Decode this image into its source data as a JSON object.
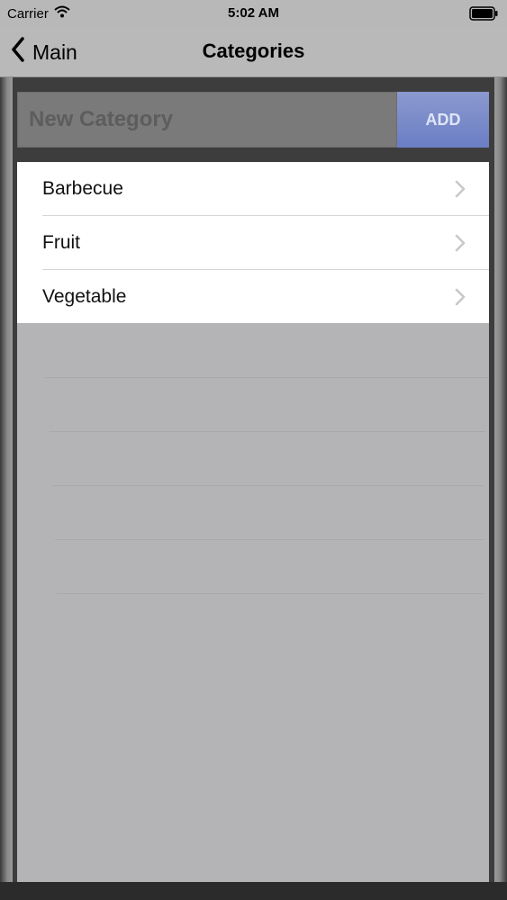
{
  "status_bar": {
    "carrier": "Carrier",
    "time": "5:02 AM"
  },
  "nav": {
    "back_label": "Main",
    "title": "Categories"
  },
  "add_form": {
    "placeholder": "New Category",
    "value": "",
    "add_label": "ADD"
  },
  "categories": [
    {
      "label": "Barbecue"
    },
    {
      "label": "Fruit"
    },
    {
      "label": "Vegetable"
    }
  ],
  "icons": {
    "wifi": "wifi-icon",
    "battery": "battery-icon",
    "back": "chevron-left-icon",
    "disclosure": "chevron-right-icon"
  },
  "colors": {
    "add_button": "#7284c7",
    "nav_background": "#b9b9b9",
    "list_background": "#ffffff",
    "dimmed_background": "#b4b3b6"
  }
}
